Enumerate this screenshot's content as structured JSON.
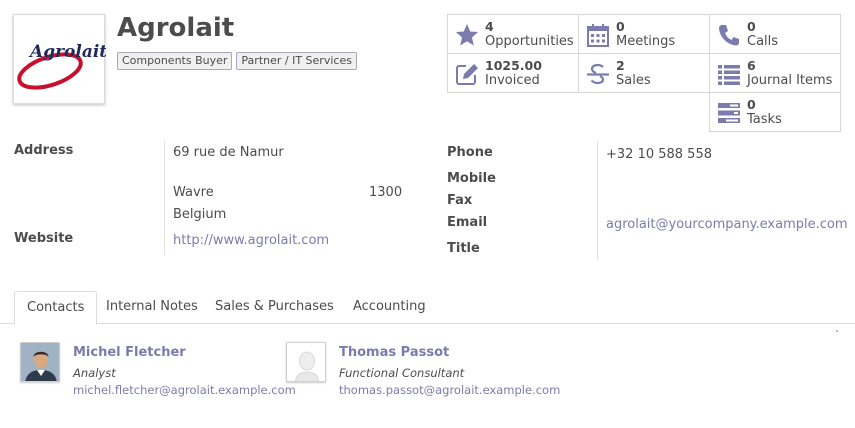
{
  "partner": {
    "name": "Agrolait",
    "logo_text": "Agrolait",
    "tags": [
      "Components Buyer",
      "Partner / IT Services"
    ]
  },
  "stats": [
    {
      "value": "4",
      "label": "Opportunities",
      "icon": "star-icon"
    },
    {
      "value": "0",
      "label": "Meetings",
      "icon": "calendar-icon"
    },
    {
      "value": "0",
      "label": "Calls",
      "icon": "phone-icon"
    },
    {
      "value": "1025.00",
      "label": "Invoiced",
      "icon": "pencil-square-icon"
    },
    {
      "value": "2",
      "label": "Sales",
      "icon": "strikethrough-icon"
    },
    {
      "value": "6",
      "label": "Journal Items",
      "icon": "list-icon"
    },
    {
      "value": "0",
      "label": "Tasks",
      "icon": "tasks-icon"
    }
  ],
  "address": {
    "label": "Address",
    "street": "69 rue de Namur",
    "city": "Wavre",
    "zip": "1300",
    "country": "Belgium"
  },
  "website": {
    "label": "Website",
    "value": "http://www.agrolait.com"
  },
  "contact_fields": {
    "phone_label": "Phone",
    "phone": "+32 10 588 558",
    "mobile_label": "Mobile",
    "fax_label": "Fax",
    "email_label": "Email",
    "email": "agrolait@yourcompany.example.com",
    "title_label": "Title"
  },
  "tabs": [
    "Contacts",
    "Internal Notes",
    "Sales & Purchases",
    "Accounting"
  ],
  "active_tab": "Contacts",
  "contacts": [
    {
      "name": "Michel Fletcher",
      "title": "Analyst",
      "email": "michel.fletcher@agrolait.example.com"
    },
    {
      "name": "Thomas Passot",
      "title": "Functional Consultant",
      "email": "thomas.passot@agrolait.example.com"
    }
  ],
  "colors": {
    "accent": "#7c7bad",
    "text": "#4c4c4c",
    "border": "#d6d6d6"
  }
}
